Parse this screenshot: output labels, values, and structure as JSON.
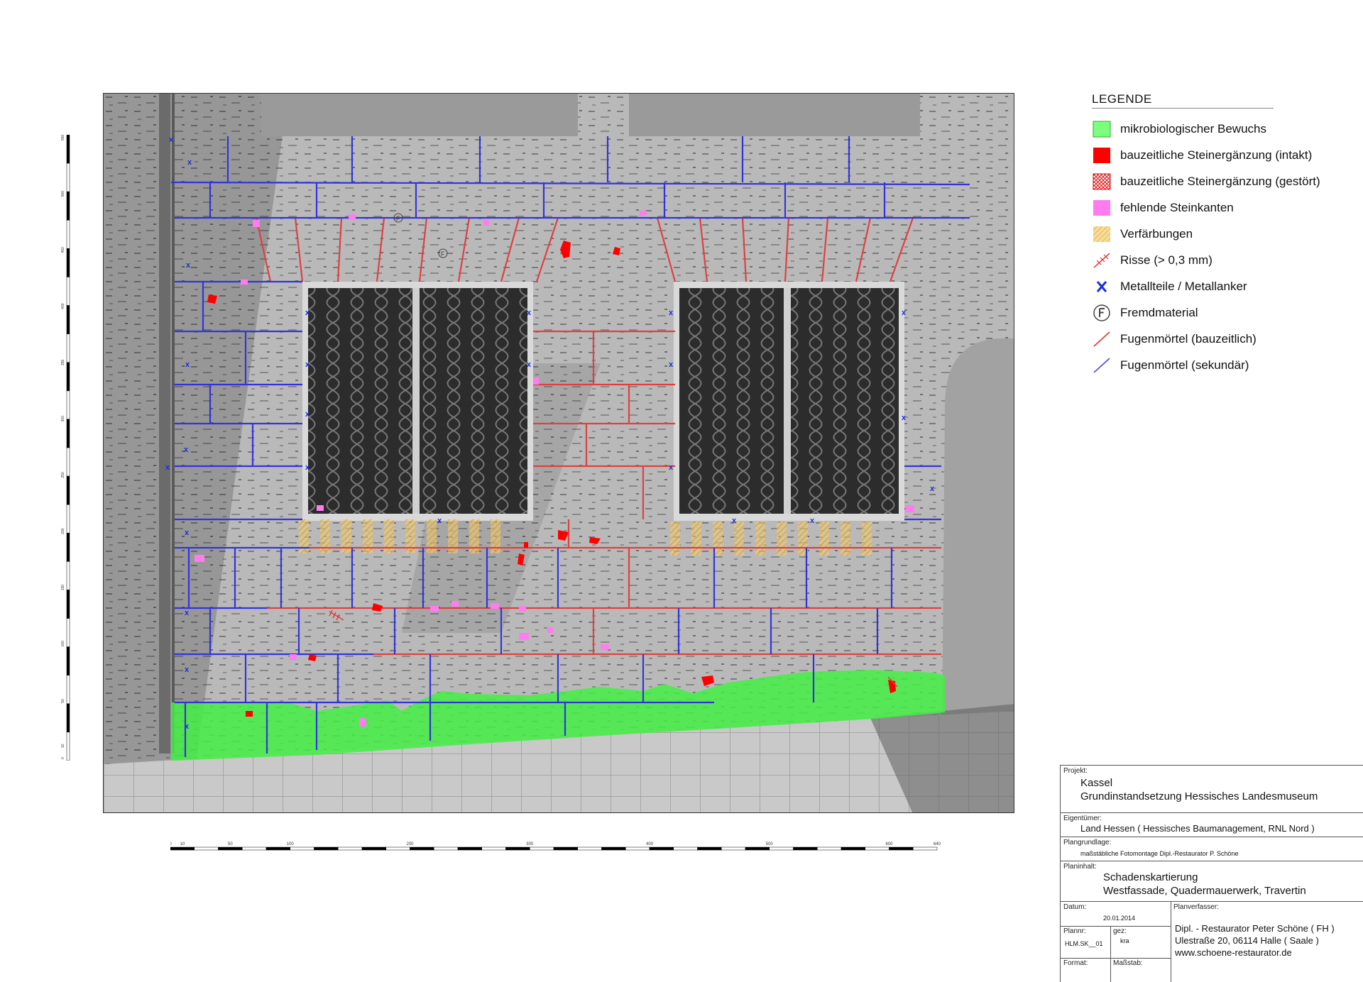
{
  "colors": {
    "bewuchs": "#44ee44",
    "steinergaenzung": "#ff0000",
    "steinkanten": "#ff7cf0",
    "verfaerbung": "#e6b84a",
    "fuge_bauzeitlich": "#e04040",
    "fuge_sekundaer": "#3333dd",
    "metall": "#1a2fd8"
  },
  "legend": {
    "title": "LEGENDE",
    "items": [
      {
        "icon": "green-square-icon",
        "label": "mikrobiologischer Bewuchs"
      },
      {
        "icon": "red-square-icon",
        "label": "bauzeitliche Steinergänzung (intakt)"
      },
      {
        "icon": "red-crosshatch-icon",
        "label": "bauzeitliche Steinergänzung (gestört)"
      },
      {
        "icon": "pink-square-icon",
        "label": "fehlende Steinkanten"
      },
      {
        "icon": "yellow-hatch-icon",
        "label": "Verfärbungen"
      },
      {
        "icon": "crack-icon",
        "label": "Risse (> 0,3 mm)"
      },
      {
        "icon": "blue-x-icon",
        "label": "Metallteile / Metallanker"
      },
      {
        "icon": "circled-f-icon",
        "label": "Fremdmaterial"
      },
      {
        "icon": "red-line-icon",
        "label": "Fugenmörtel (bauzeitlich)"
      },
      {
        "icon": "blue-line-icon",
        "label": "Fugenmörtel (sekundär)"
      }
    ]
  },
  "photo": {
    "fremdmaterial_mark": "F",
    "metal_mark": "x"
  },
  "scales": {
    "vertical_ticks": [
      "0",
      "10",
      "50",
      "100",
      "150",
      "200",
      "250",
      "300",
      "350",
      "400",
      "450",
      "500",
      "550"
    ],
    "horizontal_ticks": [
      "0",
      "10",
      "50",
      "100",
      "200",
      "300",
      "400",
      "500",
      "600",
      "640"
    ]
  },
  "titleblock": {
    "projekt_label": "Projekt:",
    "projekt_city": "Kassel",
    "projekt_name": "Grundinstandsetzung Hessisches Landesmuseum",
    "eigentuemer_label": "Eigentümer:",
    "eigentuemer": "Land Hessen  ( Hessisches Baumanagement, RNL Nord )",
    "plangrundlage_label": "Plangrundlage:",
    "plangrundlage": "maßstäbliche Fotomontage Dipl.-Restaurator P. Schöne",
    "planinhalt_label": "Planinhalt:",
    "planinhalt_1": "Schadenskartierung",
    "planinhalt_2": "Westfassade,  Quadermauerwerk, Travertin",
    "datum_label": "Datum:",
    "datum": "20.01.2014",
    "planverfasser_label": "Planverfasser:",
    "plannr_label": "Plannr:",
    "plannr": "HLM.SK__01",
    "gez_label": "gez:",
    "gez": "kra",
    "format_label": "Format:",
    "massstab_label": "Maßstab:",
    "verfasser_1": "Dipl. - Restaurator Peter Schöne  ( FH )",
    "verfasser_2": "Ulestraße 20, 06114 Halle ( Saale )",
    "verfasser_3": "www.schoene-restaurator.de"
  }
}
